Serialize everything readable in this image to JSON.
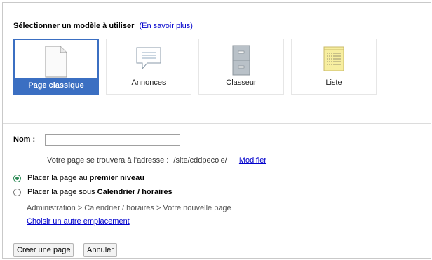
{
  "header": {
    "title": "Sélectionner un modèle à utiliser",
    "learn_more": "(En savoir plus)"
  },
  "templates": [
    {
      "label": "Page classique",
      "icon": "page-icon",
      "selected": true
    },
    {
      "label": "Annonces",
      "icon": "speech-bubble-icon",
      "selected": false
    },
    {
      "label": "Classeur",
      "icon": "file-cabinet-icon",
      "selected": false
    },
    {
      "label": "Liste",
      "icon": "list-icon",
      "selected": false
    }
  ],
  "name_field": {
    "label": "Nom :",
    "value": ""
  },
  "address": {
    "prefix": "Votre page se trouvera à l'adresse :",
    "path": "/site/cddpecole/",
    "modify": "Modifier"
  },
  "placement": {
    "option1_prefix": "Placer la page au ",
    "option1_bold": "premier niveau",
    "option2_prefix": "Placer la page sous ",
    "option2_bold": "Calendrier / horaires",
    "breadcrumb": "Administration > Calendrier / horaires > Votre nouvelle page",
    "choose_other": "Choisir un autre emplacement"
  },
  "buttons": {
    "create": "Créer une page",
    "cancel": "Annuler"
  },
  "colors": {
    "accent": "#3b6fc2",
    "link": "#0000cc",
    "radio_checked": "#2e8b57"
  }
}
